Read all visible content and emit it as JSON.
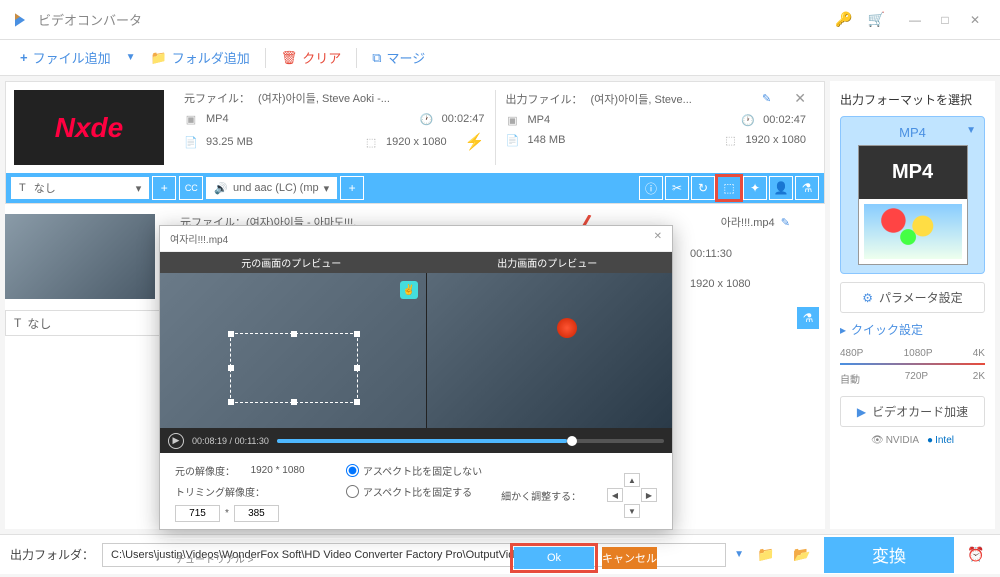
{
  "app": {
    "title": "ビデオコンバータ"
  },
  "toolbar": {
    "add_file": "ファイル追加",
    "add_folder": "フォルダ追加",
    "clear": "クリア",
    "merge": "マージ"
  },
  "file1": {
    "thumb_text": "Nxde",
    "source": {
      "label": "元ファイル：",
      "name": "(여자)아이들, Steve Aoki -...",
      "format": "MP4",
      "duration": "00:02:47",
      "size": "93.25 MB",
      "resolution": "1920 x 1080"
    },
    "output": {
      "label": "出力ファイル：",
      "name": "(여자)아이들, Steve...",
      "format": "MP4",
      "duration": "00:02:47",
      "size": "148 MB",
      "resolution": "1920 x 1080"
    },
    "audio": {
      "track_label": "なし",
      "codec": "und aac (LC) (mp"
    }
  },
  "file2": {
    "source_partial": "元ファイル：(여자)아이들 - 아마도!!!.",
    "output_partial": "아라!!!.mp4",
    "duration": "00:11:30",
    "resolution": "1920 x 1080",
    "track_label": "なし"
  },
  "crop_dialog": {
    "title": "여자리!!!.mp4",
    "preview_source": "元の画面のプレビュー",
    "preview_output": "出力画面のプレビュー",
    "time_current": "00:08:19",
    "time_total": "00:11:30",
    "orig_res_label": "元の解像度：",
    "orig_res": "1920 * 1080",
    "trim_res_label": "トリミング解像度：",
    "trim_w": "715",
    "trim_h": "385",
    "aspect_free": "アスペクト比を固定しない",
    "aspect_lock": "アスペクト比を固定する",
    "fine_adjust": "細かく調整する：",
    "tutorial": "チュートリアル >",
    "ok": "Ok",
    "cancel": "キャンセル"
  },
  "sidebar": {
    "format_title": "出力フォーマットを選択",
    "format": "MP4",
    "params": "パラメータ設定",
    "quick": "クイック設定",
    "q480": "480P",
    "q720": "720P",
    "q1080": "1080P",
    "q2k": "2K",
    "q4k": "4K",
    "qauto": "自動",
    "gpu_accel": "ビデオカード加速",
    "nvidia": "NVIDIA",
    "intel": "Intel"
  },
  "bottom": {
    "label": "出力フォルダ：",
    "path": "C:\\Users\\justin\\Videos\\WonderFox Soft\\HD Video Converter Factory Pro\\OutputVideo\\",
    "convert": "変換"
  }
}
